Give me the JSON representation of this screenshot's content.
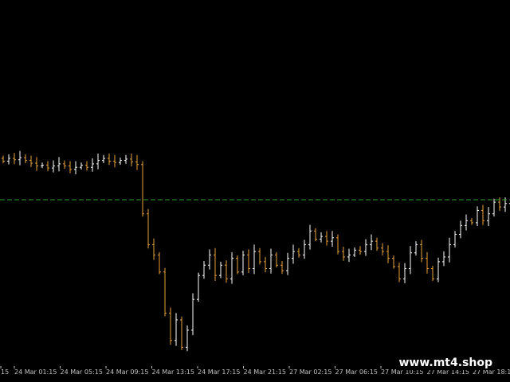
{
  "chart_data": {
    "type": "ohlc",
    "x_ticks": [
      "24 Mar 01:15",
      "24 Mar 05:15",
      "24 Mar 09:15",
      "24 Mar 13:15",
      "24 Mar 17:15",
      "24 Mar 21:15",
      "27 Mar 02:15",
      "27 Mar 06:15",
      "27 Mar 10:15",
      "27 Mar 14:15",
      "27 Mar 18:15"
    ],
    "x_ticks_partial": [
      "15"
    ],
    "bar_color_up": "#ffffff",
    "bar_color_down": "#e8a33c",
    "level_line": {
      "style": "dashed",
      "color": "#2e9d2e"
    },
    "closes": [
      3.2,
      3.6,
      3.4,
      3.7,
      3.3,
      2.9,
      2.5,
      2.6,
      2.2,
      2.5,
      2.8,
      2.5,
      2.0,
      2.3,
      2.6,
      2.3,
      2.8,
      3.3,
      3.6,
      3.2,
      3.0,
      3.3,
      3.5,
      3.1,
      2.7,
      -4.5,
      -9.0,
      -10.5,
      -13.0,
      -19.0,
      -23.0,
      -20.0,
      -24.0,
      -21.5,
      -17.0,
      -13.5,
      -12.0,
      -10.5,
      -13.5,
      -12.0,
      -14.0,
      -11.0,
      -13.0,
      -10.5,
      -12.5,
      -10.0,
      -11.5,
      -12.5,
      -10.5,
      -12.0,
      -12.8,
      -11.0,
      -10.0,
      -10.5,
      -9.0,
      -7.0,
      -8.2,
      -7.8,
      -8.5,
      -8.0,
      -10.0,
      -10.8,
      -10.5,
      -9.8,
      -10.0,
      -9.0,
      -8.5,
      -9.5,
      -10.0,
      -11.0,
      -12.2,
      -14.0,
      -12.5,
      -10.2,
      -9.0,
      -11.0,
      -12.5,
      -14.0,
      -11.5,
      -10.8,
      -9.0,
      -7.5,
      -6.2,
      -5.5,
      -5.8,
      -4.0,
      -5.5,
      -4.5,
      -2.8,
      -3.5,
      -3.0,
      -2.5
    ]
  },
  "watermark": "www.mt4.shop"
}
